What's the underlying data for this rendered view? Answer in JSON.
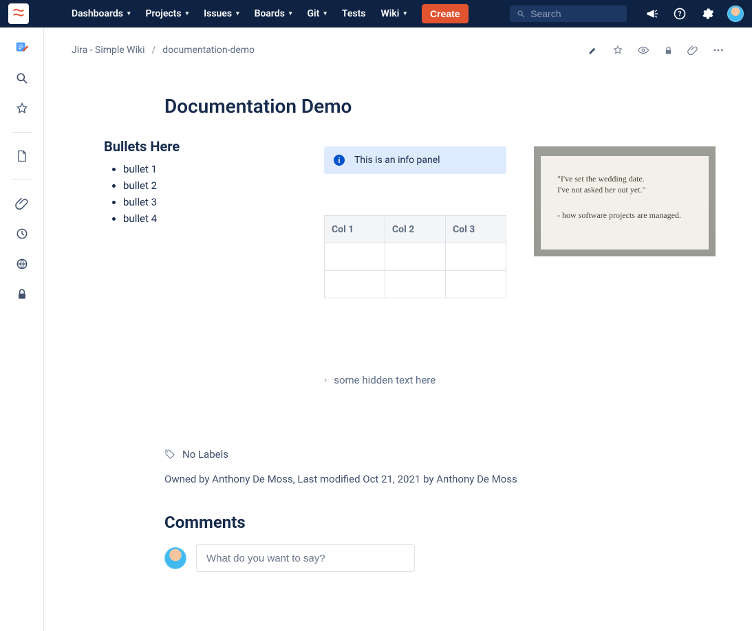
{
  "topnav": {
    "items": [
      "Dashboards",
      "Projects",
      "Issues",
      "Boards",
      "Git",
      "Tests",
      "Wiki"
    ],
    "items_has_chevron": [
      true,
      true,
      true,
      true,
      true,
      false,
      true
    ],
    "create_label": "Create",
    "search_placeholder": "Search"
  },
  "breadcrumb": {
    "space": "Jira - Simple Wiki",
    "page": "documentation-demo"
  },
  "page": {
    "title": "Documentation Demo",
    "bullets_heading": "Bullets Here",
    "bullets": [
      "bullet 1",
      "bullet 2",
      "bullet 3",
      "bullet 4"
    ],
    "info_panel_text": "This is an info panel",
    "table_headers": [
      "Col 1",
      "Col 2",
      "Col 3"
    ],
    "image_quote_line1": "\"I've set the wedding date.",
    "image_quote_line2": "I've not asked her out yet.\"",
    "image_caption": "- how software projects are managed.",
    "expand_text": "some hidden text here",
    "labels_text": "No Labels",
    "meta_text": "Owned by Anthony De Moss, Last modified Oct 21, 2021 by Anthony De Moss"
  },
  "comments": {
    "heading": "Comments",
    "placeholder": "What do you want to say?"
  }
}
